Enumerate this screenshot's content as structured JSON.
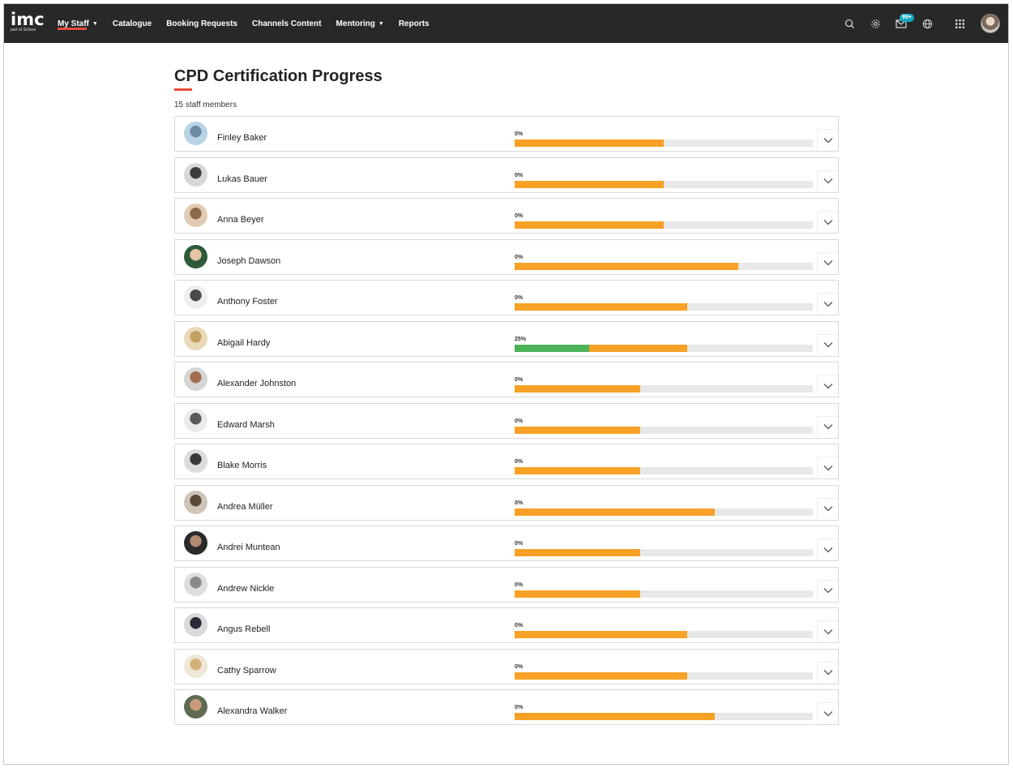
{
  "nav": {
    "logo": "imc",
    "logo_sub": "part of Scheer",
    "items": [
      {
        "label": "My Staff",
        "dropdown": true,
        "active": true
      },
      {
        "label": "Catalogue",
        "dropdown": false
      },
      {
        "label": "Booking Requests",
        "dropdown": false
      },
      {
        "label": "Channels Content",
        "dropdown": false
      },
      {
        "label": "Mentoring",
        "dropdown": true
      },
      {
        "label": "Reports",
        "dropdown": false
      }
    ],
    "icons": [
      "search-icon",
      "settings-icon",
      "mail-icon",
      "globe-icon",
      "apps-grid-icon"
    ],
    "mail_badge": "99+"
  },
  "page": {
    "title": "CPD Certification Progress",
    "count": "15 staff members"
  },
  "colors": {
    "accent": "#e94b3c",
    "progress_total": "#f7a126",
    "progress_done": "#4cb35a",
    "topbar": "#282828",
    "badge": "#15a8c4"
  },
  "staff": [
    {
      "name": "Finley Baker",
      "progress_label": "0%",
      "done": 0.0,
      "total": 0.5
    },
    {
      "name": "Lukas Bauer",
      "progress_label": "0%",
      "done": 0.0,
      "total": 0.5
    },
    {
      "name": "Anna Beyer",
      "progress_label": "0%",
      "done": 0.0,
      "total": 0.5
    },
    {
      "name": "Joseph Dawson",
      "progress_label": "0%",
      "done": 0.0,
      "total": 0.75
    },
    {
      "name": "Anthony Foster",
      "progress_label": "0%",
      "done": 0.0,
      "total": 0.58
    },
    {
      "name": "Abigail Hardy",
      "progress_label": "25%",
      "done": 0.25,
      "total": 0.58
    },
    {
      "name": "Alexander Johnston",
      "progress_label": "0%",
      "done": 0.0,
      "total": 0.42
    },
    {
      "name": "Edward Marsh",
      "progress_label": "0%",
      "done": 0.0,
      "total": 0.42
    },
    {
      "name": "Blake Morris",
      "progress_label": "0%",
      "done": 0.0,
      "total": 0.42
    },
    {
      "name": "Andrea Müller",
      "progress_label": "0%",
      "done": 0.0,
      "total": 0.67
    },
    {
      "name": "Andrei Muntean",
      "progress_label": "0%",
      "done": 0.0,
      "total": 0.42
    },
    {
      "name": "Andrew Nickle",
      "progress_label": "0%",
      "done": 0.0,
      "total": 0.42
    },
    {
      "name": "Angus Rebell",
      "progress_label": "0%",
      "done": 0.0,
      "total": 0.58
    },
    {
      "name": "Cathy Sparrow",
      "progress_label": "0%",
      "done": 0.0,
      "total": 0.58
    },
    {
      "name": "Alexandra Walker",
      "progress_label": "0%",
      "done": 0.0,
      "total": 0.67
    }
  ]
}
